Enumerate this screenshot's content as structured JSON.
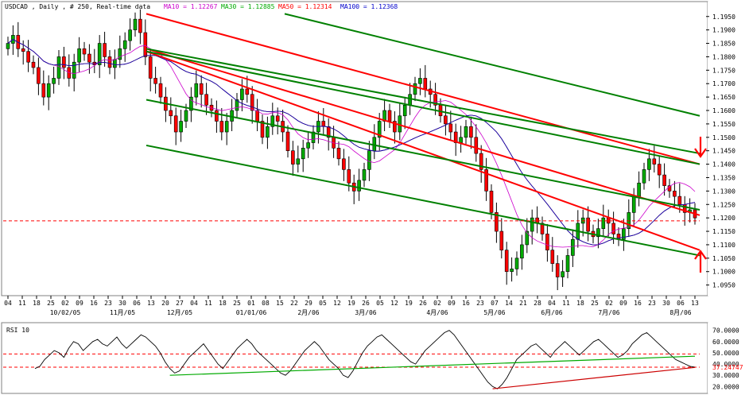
{
  "header": {
    "symbol_text": "USDCAD , Daily , # 250, Real-time data",
    "ma_legend": [
      {
        "text": "MA10 = 1.12267",
        "color": "#cc00cc"
      },
      {
        "text": "MA30 = 1.12885",
        "color": "#00aa00"
      },
      {
        "text": "MA50 = 1.12314",
        "color": "#ff0000"
      },
      {
        "text": "MA100 = 1.12368",
        "color": "#0000cc"
      }
    ]
  },
  "colors": {
    "up_candle": "#00aa00",
    "down_candle": "#ff0000",
    "trendline_red": "#ff0000",
    "trendline_green": "#008000",
    "arrow": "#ff0000",
    "dashed_level": "#ff0000",
    "ma10": "#cc00cc",
    "ma30": "#00aa00",
    "ma50": "#ff0000",
    "ma100": "#0000cc",
    "rsi_line": "#000000"
  },
  "chart_data": [
    {
      "type": "candlestick",
      "title": "USDCAD , Daily , # 250, Real-time data",
      "y_ticks": [
        "1.1950",
        "1.1900",
        "1.1850",
        "1.1800",
        "1.1750",
        "1.1700",
        "1.1650",
        "1.1600",
        "1.1550",
        "1.1500",
        "1.1450",
        "1.1400",
        "1.1350",
        "1.1300",
        "1.1250",
        "1.1200",
        "1.1150",
        "1.1100",
        "1.1050",
        "1.1000",
        "1.0950"
      ],
      "ylim": [
        1.094,
        1.197
      ],
      "x_day_labels": [
        "04",
        "11",
        "18",
        "25",
        "02",
        "09",
        "16",
        "23",
        "30",
        "06",
        "13",
        "20",
        "27",
        "04",
        "11",
        "18",
        "25",
        "01",
        "08",
        "15",
        "22",
        "29",
        "05",
        "12",
        "19",
        "26",
        "05",
        "12",
        "19",
        "26",
        "02",
        "09",
        "16",
        "23",
        "07",
        "14",
        "21",
        "28",
        "04",
        "11",
        "18",
        "25",
        "02",
        "09",
        "16",
        "23",
        "30",
        "06",
        "13"
      ],
      "x_month_labels": [
        {
          "text": "10/02/05",
          "index": 4
        },
        {
          "text": "11月/05",
          "index": 8
        },
        {
          "text": "12月/05",
          "index": 12
        },
        {
          "text": "01/01/06",
          "index": 17
        },
        {
          "text": "2月/06",
          "index": 21
        },
        {
          "text": "3月/06",
          "index": 25
        },
        {
          "text": "4月/06",
          "index": 30
        },
        {
          "text": "5月/06",
          "index": 34
        },
        {
          "text": "6月/06",
          "index": 38
        },
        {
          "text": "7月/06",
          "index": 42
        },
        {
          "text": "8月/06",
          "index": 47
        }
      ],
      "close_series": [
        1.185,
        1.188,
        1.183,
        1.182,
        1.178,
        1.176,
        1.17,
        1.165,
        1.17,
        1.172,
        1.18,
        1.176,
        1.172,
        1.178,
        1.183,
        1.181,
        1.178,
        1.177,
        1.185,
        1.18,
        1.176,
        1.179,
        1.183,
        1.186,
        1.19,
        1.194,
        1.189,
        1.18,
        1.172,
        1.17,
        1.165,
        1.16,
        1.158,
        1.152,
        1.156,
        1.16,
        1.165,
        1.17,
        1.166,
        1.162,
        1.16,
        1.156,
        1.152,
        1.156,
        1.16,
        1.164,
        1.168,
        1.166,
        1.16,
        1.156,
        1.15,
        1.154,
        1.158,
        1.156,
        1.152,
        1.145,
        1.14,
        1.142,
        1.146,
        1.148,
        1.152,
        1.156,
        1.154,
        1.15,
        1.146,
        1.142,
        1.138,
        1.133,
        1.13,
        1.134,
        1.138,
        1.145,
        1.15,
        1.156,
        1.16,
        1.156,
        1.152,
        1.158,
        1.162,
        1.166,
        1.17,
        1.172,
        1.168,
        1.166,
        1.162,
        1.158,
        1.155,
        1.152,
        1.148,
        1.15,
        1.154,
        1.15,
        1.144,
        1.138,
        1.13,
        1.122,
        1.115,
        1.108,
        1.1,
        1.101,
        1.105,
        1.11,
        1.115,
        1.12,
        1.118,
        1.114,
        1.108,
        1.103,
        1.098,
        1.1,
        1.106,
        1.112,
        1.118,
        1.12,
        1.115,
        1.113,
        1.116,
        1.12,
        1.118,
        1.114,
        1.112,
        1.116,
        1.122,
        1.128,
        1.133,
        1.138,
        1.142,
        1.14,
        1.136,
        1.132,
        1.13,
        1.128,
        1.125,
        1.122,
        1.123,
        1.12
      ],
      "trendlines_red": [
        {
          "from": [
            0,
            1.196
          ],
          "to": [
            1,
            1.14
          ]
        },
        {
          "from": [
            0,
            1.183
          ],
          "to": [
            1,
            1.121
          ]
        },
        {
          "from": [
            0,
            1.182
          ],
          "to": [
            1,
            1.108
          ]
        }
      ],
      "trendlines_green": [
        {
          "from": [
            0,
            1.183
          ],
          "to": [
            1,
            1.144
          ]
        },
        {
          "from": [
            0,
            1.182
          ],
          "to": [
            1,
            1.14
          ]
        },
        {
          "from": [
            0,
            1.164
          ],
          "to": [
            1,
            1.123
          ]
        },
        {
          "from": [
            0,
            1.147
          ],
          "to": [
            1,
            1.106
          ]
        },
        {
          "from": [
            0.25,
            1.196
          ],
          "to": [
            1,
            1.158
          ]
        }
      ],
      "horizontal_level": 1.1189,
      "arrows": [
        {
          "position": "upper-right",
          "direction": "down"
        },
        {
          "position": "lower-right",
          "direction": "up"
        }
      ]
    },
    {
      "type": "line",
      "title": "RSI 10",
      "y_ticks": [
        "70.0000",
        "60.0000",
        "50.0000",
        "40.0000",
        "30.0000",
        "20.0000"
      ],
      "ylim": [
        16,
        74
      ],
      "last_value_label": "37.24747",
      "dashed_levels": [
        49,
        37.2
      ],
      "values": [
        36,
        38,
        44,
        48,
        52,
        50,
        46,
        54,
        60,
        58,
        52,
        56,
        60,
        62,
        58,
        56,
        60,
        64,
        58,
        54,
        58,
        62,
        66,
        64,
        60,
        56,
        50,
        42,
        36,
        32,
        34,
        40,
        46,
        50,
        54,
        58,
        52,
        46,
        40,
        36,
        42,
        48,
        54,
        58,
        62,
        58,
        52,
        48,
        44,
        40,
        36,
        32,
        30,
        34,
        40,
        46,
        52,
        56,
        60,
        56,
        50,
        44,
        40,
        36,
        30,
        28,
        34,
        42,
        50,
        56,
        60,
        64,
        66,
        62,
        58,
        54,
        50,
        46,
        42,
        40,
        46,
        52,
        56,
        60,
        64,
        68,
        70,
        66,
        60,
        54,
        48,
        42,
        36,
        30,
        24,
        20,
        18,
        22,
        28,
        36,
        44,
        48,
        52,
        56,
        58,
        54,
        50,
        46,
        52,
        56,
        60,
        56,
        52,
        48,
        52,
        56,
        60,
        62,
        58,
        54,
        50,
        46,
        48,
        52,
        58,
        62,
        66,
        68,
        64,
        60,
        56,
        52,
        48,
        44,
        42,
        40,
        38,
        37.2
      ]
    }
  ]
}
